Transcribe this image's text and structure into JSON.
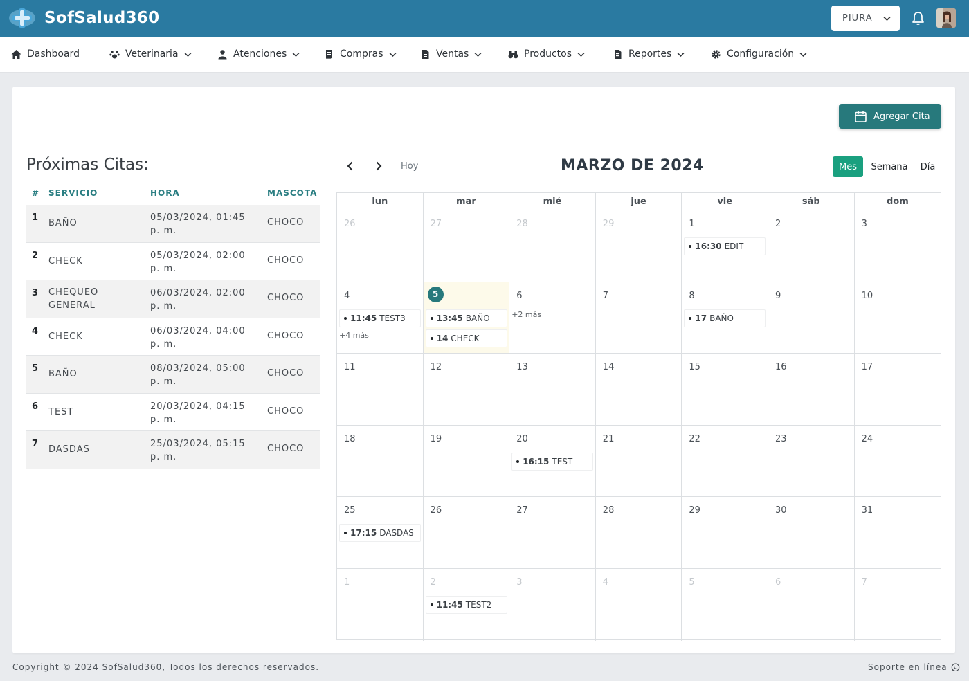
{
  "header": {
    "brand": "SofSalud360",
    "branch": "PIURA"
  },
  "nav": [
    {
      "label": "Dashboard",
      "icon": "home-icon"
    },
    {
      "label": "Veterinaria",
      "icon": "paw-icon"
    },
    {
      "label": "Atenciones",
      "icon": "user-icon"
    },
    {
      "label": "Compras",
      "icon": "receipt-icon"
    },
    {
      "label": "Ventas",
      "icon": "file-invoice-icon"
    },
    {
      "label": "Productos",
      "icon": "binoculars-icon"
    },
    {
      "label": "Reportes",
      "icon": "file-icon"
    },
    {
      "label": "Configuración",
      "icon": "gear-icon"
    }
  ],
  "actions": {
    "add_appointment": "Agregar Cita"
  },
  "upcoming": {
    "title": "Próximas Citas:",
    "columns": [
      "#",
      "SERVICIO",
      "HORA",
      "MASCOTA"
    ],
    "rows": [
      {
        "n": "1",
        "service": "BAÑO",
        "date": "05/03/2024, 01:45",
        "ampm": "p. m.",
        "pet": "CHOCO"
      },
      {
        "n": "2",
        "service": "CHECK",
        "date": "05/03/2024, 02:00",
        "ampm": "p. m.",
        "pet": "CHOCO"
      },
      {
        "n": "3",
        "service": "CHEQUEO GENERAL",
        "date": "06/03/2024, 02:00",
        "ampm": "p. m.",
        "pet": "CHOCO"
      },
      {
        "n": "4",
        "service": "CHECK",
        "date": "06/03/2024, 04:00",
        "ampm": "p. m.",
        "pet": "CHOCO"
      },
      {
        "n": "5",
        "service": "BAÑO",
        "date": "08/03/2024, 05:00",
        "ampm": "p. m.",
        "pet": "CHOCO"
      },
      {
        "n": "6",
        "service": "TEST",
        "date": "20/03/2024, 04:15",
        "ampm": "p. m.",
        "pet": "CHOCO"
      },
      {
        "n": "7",
        "service": "DASDAS",
        "date": "25/03/2024, 05:15",
        "ampm": "p. m.",
        "pet": "CHOCO"
      }
    ]
  },
  "calendar": {
    "today_label": "Hoy",
    "title": "MARZO DE 2024",
    "views": [
      "Mes",
      "Semana",
      "Día"
    ],
    "active_view": "Mes",
    "weekdays": [
      "lun",
      "mar",
      "mié",
      "jue",
      "vie",
      "sáb",
      "dom"
    ],
    "weeks": [
      [
        {
          "day": "26",
          "other": true
        },
        {
          "day": "27",
          "other": true
        },
        {
          "day": "28",
          "other": true
        },
        {
          "day": "29",
          "other": true
        },
        {
          "day": "1",
          "events": [
            {
              "time": "16:30",
              "title": "EDIT"
            }
          ]
        },
        {
          "day": "2"
        },
        {
          "day": "3"
        }
      ],
      [
        {
          "day": "4",
          "events": [
            {
              "time": "11:45",
              "title": "TEST3"
            }
          ],
          "more": "+4 más"
        },
        {
          "day": "5",
          "today": true,
          "events": [
            {
              "time": "13:45",
              "title": "BAÑO"
            },
            {
              "time": "14",
              "title": "CHECK"
            }
          ]
        },
        {
          "day": "6",
          "more": "+2 más"
        },
        {
          "day": "7"
        },
        {
          "day": "8",
          "events": [
            {
              "time": "17",
              "title": "BAÑO"
            }
          ]
        },
        {
          "day": "9"
        },
        {
          "day": "10"
        }
      ],
      [
        {
          "day": "11"
        },
        {
          "day": "12"
        },
        {
          "day": "13"
        },
        {
          "day": "14"
        },
        {
          "day": "15"
        },
        {
          "day": "16"
        },
        {
          "day": "17"
        }
      ],
      [
        {
          "day": "18"
        },
        {
          "day": "19"
        },
        {
          "day": "20",
          "events": [
            {
              "time": "16:15",
              "title": "TEST"
            }
          ]
        },
        {
          "day": "21"
        },
        {
          "day": "22"
        },
        {
          "day": "23"
        },
        {
          "day": "24"
        }
      ],
      [
        {
          "day": "25",
          "events": [
            {
              "time": "17:15",
              "title": "DASDAS"
            }
          ]
        },
        {
          "day": "26"
        },
        {
          "day": "27"
        },
        {
          "day": "28"
        },
        {
          "day": "29"
        },
        {
          "day": "30"
        },
        {
          "day": "31"
        }
      ],
      [
        {
          "day": "1",
          "other": true
        },
        {
          "day": "2",
          "other": true,
          "events": [
            {
              "time": "11:45",
              "title": "TEST2"
            }
          ]
        },
        {
          "day": "3",
          "other": true
        },
        {
          "day": "4",
          "other": true
        },
        {
          "day": "5",
          "other": true
        },
        {
          "day": "6",
          "other": true
        },
        {
          "day": "7",
          "other": true
        }
      ]
    ]
  },
  "footer": {
    "copyright": "Copyright © 2024 SofSalud360, Todos los derechos reservados.",
    "support": "Soporte en línea"
  },
  "colors": {
    "header": "#2a7aa1",
    "accent": "#27797c",
    "active_view": "#1aa07f",
    "today_bg": "#fdfaea"
  }
}
